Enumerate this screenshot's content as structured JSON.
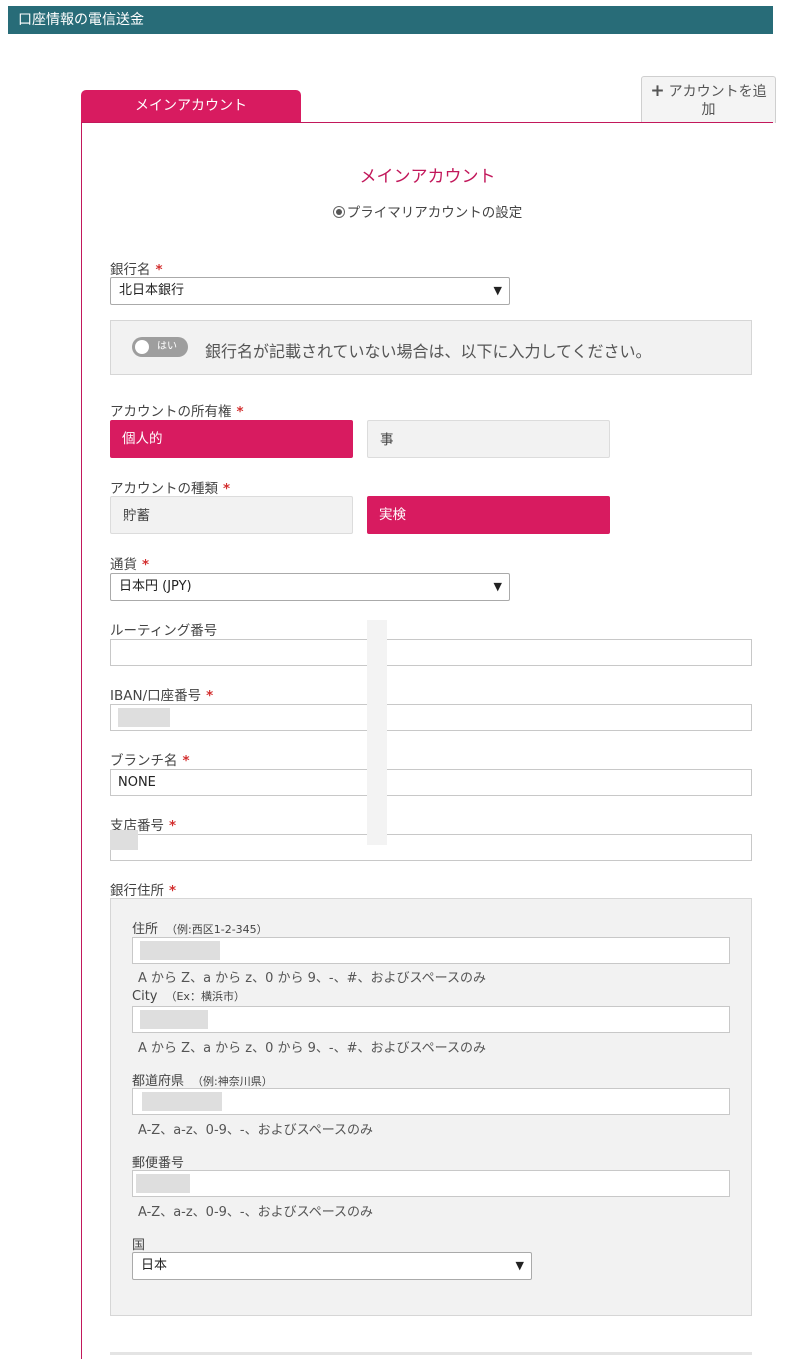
{
  "header": {
    "title": "口座情報の電信送金"
  },
  "tabs": {
    "main_label": "メインアカウント",
    "add_label": "アカウントを追加"
  },
  "account": {
    "title": "メインアカウント",
    "primary_label": "プライマリアカウントの設定"
  },
  "bank": {
    "label": "銀行名",
    "selected": "北日本銀行",
    "toggle_text": "はい",
    "toggle_message": "銀行名が記載されていない場合は、以下に入力してください。"
  },
  "ownership": {
    "label": "アカウントの所有権",
    "options": [
      "個人的",
      "事"
    ],
    "selected": "個人的"
  },
  "type": {
    "label": "アカウントの種類",
    "options": [
      "貯蓄",
      "実検"
    ],
    "selected": "実検"
  },
  "currency": {
    "label": "通貨",
    "selected": "日本円 (JPY)"
  },
  "routing": {
    "label": "ルーティング番号",
    "value": ""
  },
  "iban": {
    "label": "IBAN/口座番号",
    "value": ""
  },
  "branch_name": {
    "label": "ブランチ名",
    "value": "NONE"
  },
  "branch_number": {
    "label": "支店番号",
    "value": ""
  },
  "address": {
    "label": "銀行住所",
    "street": {
      "label": "住所",
      "example": "（例:西区1-2-345）",
      "value": "",
      "hint": "A から Z、a から z、0 から 9、-、#、およびスペースのみ"
    },
    "city": {
      "label": "City",
      "example": "（Ex：横浜市）",
      "value": "",
      "hint": "A から Z、a から z、0 から 9、-、#、およびスペースのみ"
    },
    "prefecture": {
      "label": "都道府県",
      "example": "（例:神奈川県）",
      "value": "",
      "hint": "A-Z、a-z、0-9、-、およびスペースのみ"
    },
    "postal": {
      "label": "郵便番号",
      "value": "",
      "hint": "A-Z、a-z、0-9、-、およびスペースのみ"
    },
    "country": {
      "label": "国",
      "selected": "日本"
    }
  },
  "colors": {
    "header_bg": "#286c78",
    "accent": "#d81b60",
    "required": "#d32f2f"
  }
}
